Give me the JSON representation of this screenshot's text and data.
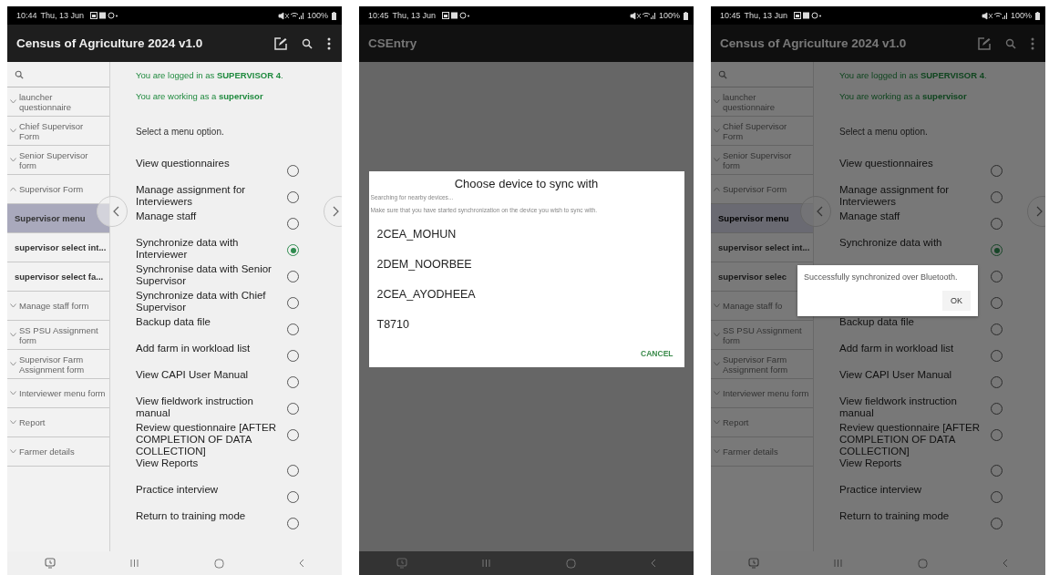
{
  "screens": [
    {
      "kind": "menu",
      "dimmed": false,
      "status_bar": {
        "time": "10:44",
        "date": "Thu, 13 Jun",
        "battery": "100%"
      },
      "app_bar": {
        "title": "Census of Agriculture 2024 v1.0"
      },
      "sidebar": [
        {
          "kind": "group",
          "label": "launcher questionnaire",
          "expanded": false
        },
        {
          "kind": "group",
          "label": "Chief Supervisor Form",
          "expanded": false
        },
        {
          "kind": "group",
          "label": "Senior Supervisor form",
          "expanded": false
        },
        {
          "kind": "group",
          "label": "Supervisor Form",
          "expanded": true
        },
        {
          "kind": "form",
          "label": "Supervisor menu",
          "selected": true
        },
        {
          "kind": "form",
          "label": "supervisor select int...",
          "selected": false
        },
        {
          "kind": "form",
          "label": "supervisor select fa...",
          "selected": false
        },
        {
          "kind": "group",
          "label": "Manage staff form",
          "expanded": false
        },
        {
          "kind": "group",
          "label": "SS PSU Assignment form",
          "expanded": false
        },
        {
          "kind": "group",
          "label": "Supervisor Farm Assignment form",
          "expanded": false
        },
        {
          "kind": "group",
          "label": "Interviewer menu form",
          "expanded": false
        },
        {
          "kind": "group",
          "label": "Report",
          "expanded": false
        },
        {
          "kind": "group",
          "label": "Farmer details",
          "expanded": false
        }
      ],
      "messages": [
        "You are logged in as **SUPERVISOR 4**.",
        "You are working as a **supervisor**"
      ],
      "prompt": "Select a menu option.",
      "options": [
        {
          "label": "View questionnaires",
          "selected": false
        },
        {
          "label": "Manage assignment for Interviewers",
          "selected": false
        },
        {
          "label": "Manage staff",
          "selected": false
        },
        {
          "label": "Synchronize data with Interviewer",
          "selected": true
        },
        {
          "label": "Synchronise data with Senior Supervisor",
          "selected": false
        },
        {
          "label": "Synchronize data with Chief Supervisor",
          "selected": false
        },
        {
          "label": "Backup data file",
          "selected": false
        },
        {
          "label": "Add farm in workload list",
          "selected": false
        },
        {
          "label": "View CAPI User Manual",
          "selected": false
        },
        {
          "label": "View fieldwork instruction manual",
          "selected": false
        },
        {
          "label": "Review questionnaire [AFTER COMPLETION OF DATA COLLECTION]",
          "selected": false
        },
        {
          "label": "View Reports",
          "selected": false
        },
        {
          "label": "Practice interview",
          "selected": false
        },
        {
          "label": "Return to training mode",
          "selected": false
        }
      ]
    },
    {
      "kind": "device-picker",
      "status_bar": {
        "time": "10:45",
        "date": "Thu, 13 Jun",
        "battery": "100%"
      },
      "app_bar": {
        "title": "CSEntry"
      },
      "dialog": {
        "title": "Choose device to sync with",
        "status": "Searching for nearby devices...",
        "hint": "Make sure that you have started synchronization on the device you wish to sync with.",
        "devices": [
          "2CEA_MOHUN",
          "2DEM_NOORBEE",
          "2CEA_AYODHEEA",
          "T8710"
        ],
        "button": "CANCEL"
      }
    },
    {
      "kind": "menu",
      "dimmed": true,
      "status_bar": {
        "time": "10:45",
        "date": "Thu, 13 Jun",
        "battery": "100%"
      },
      "app_bar": {
        "title": "Census of Agriculture 2024 v1.0"
      },
      "sidebar": [
        {
          "kind": "group",
          "label": "launcher questionnaire",
          "expanded": false
        },
        {
          "kind": "group",
          "label": "Chief Supervisor Form",
          "expanded": false
        },
        {
          "kind": "group",
          "label": "Senior Supervisor form",
          "expanded": false
        },
        {
          "kind": "group",
          "label": "Supervisor Form",
          "expanded": true
        },
        {
          "kind": "form",
          "label": "Supervisor menu",
          "selected": true
        },
        {
          "kind": "form",
          "label": "supervisor select int...",
          "selected": false
        },
        {
          "kind": "form",
          "label": "supervisor selec",
          "selected": false
        },
        {
          "kind": "group",
          "label": "Manage staff fo",
          "expanded": false
        },
        {
          "kind": "group",
          "label": "SS PSU Assignment form",
          "expanded": false
        },
        {
          "kind": "group",
          "label": "Supervisor Farm Assignment form",
          "expanded": false
        },
        {
          "kind": "group",
          "label": "Interviewer menu form",
          "expanded": false
        },
        {
          "kind": "group",
          "label": "Report",
          "expanded": false
        },
        {
          "kind": "group",
          "label": "Farmer details",
          "expanded": false
        }
      ],
      "messages": [
        "You are logged in as **SUPERVISOR 4**.",
        "You are working as a **supervisor**"
      ],
      "prompt": "Select a menu option.",
      "options": [
        {
          "label": "View questionnaires",
          "selected": false
        },
        {
          "label": "Manage assignment for Interviewers",
          "selected": false
        },
        {
          "label": "Manage staff",
          "selected": false
        },
        {
          "label": "Synchronize data with",
          "selected": true
        },
        {
          "selected": false
        },
        {
          "selected": false
        },
        {
          "label": "Backup data file",
          "selected": false
        },
        {
          "label": "Add farm in workload list",
          "selected": false
        },
        {
          "label": "View CAPI User Manual",
          "selected": false
        },
        {
          "label": "View fieldwork instruction manual",
          "selected": false
        },
        {
          "label": "Review questionnaire [AFTER COMPLETION OF DATA COLLECTION]",
          "selected": false
        },
        {
          "label": "View Reports",
          "selected": false
        },
        {
          "label": "Practice interview",
          "selected": false
        },
        {
          "label": "Return to training mode",
          "selected": false
        }
      ],
      "dialog": {
        "message": "Successfully synchronized over Bluetooth.",
        "button": "OK"
      }
    }
  ]
}
